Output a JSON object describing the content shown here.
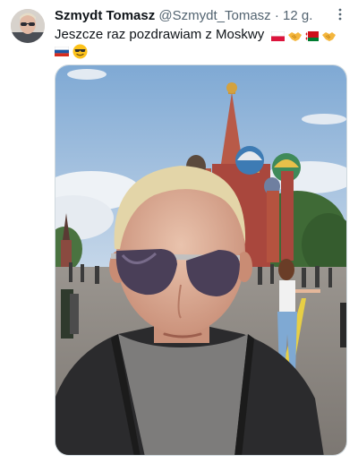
{
  "tweet": {
    "author_name": "Szmydt Tomasz",
    "author_handle": "@Szmydt_Tomasz",
    "separator": "·",
    "time": "12 g.",
    "text": "Jeszcze raz pozdrawiam z Moskwy",
    "inline_emojis": [
      "flag-poland",
      "handshake",
      "flag-belarus",
      "handshake"
    ],
    "second_line_emojis": [
      "flag-russia",
      "smiling-face-with-sunglasses"
    ]
  },
  "icons": {
    "more": "more-options-icon"
  },
  "media": {
    "description_icon": "photo",
    "colors": {
      "sky": "#8fb7dc",
      "cathedral_red": "#a9473d",
      "dome_green": "#3f8a5a",
      "dome_blue": "#3d7bb4",
      "pavement": "#8e8a86"
    }
  },
  "colors": {
    "text_primary": "#0f1419",
    "text_secondary": "#536471",
    "border": "#cfd9de"
  }
}
